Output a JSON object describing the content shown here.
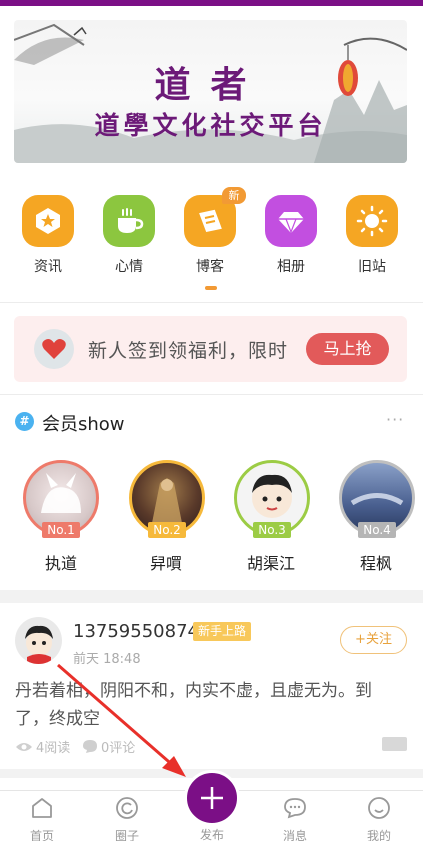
{
  "theme": {
    "brand": "#7b0f86",
    "accent": "#f29a34",
    "promo_btn": "#e25a5a"
  },
  "banner": {
    "title": "道者",
    "subtitle": "道學文化社交平台"
  },
  "quick_nav": [
    {
      "label": "资讯",
      "icon": "star-badge-icon",
      "color": "#f5a623"
    },
    {
      "label": "心情",
      "icon": "coffee-cup-icon",
      "color": "#8cc63f"
    },
    {
      "label": "博客",
      "icon": "ticket-icon",
      "color": "#f5a623",
      "badge": "新"
    },
    {
      "label": "相册",
      "icon": "diamond-icon",
      "color": "#c24fe0"
    },
    {
      "label": "旧站",
      "icon": "sun-icon",
      "color": "#f5a623"
    }
  ],
  "promo": {
    "text": "新人签到领福利，限时",
    "button": "马上抢"
  },
  "members": {
    "badge": "#",
    "title": "会员show",
    "more": "···",
    "items": [
      {
        "rank": "No.1",
        "name": "执道",
        "ring": "#ee7a6a",
        "rank_color": "#ee7a6a"
      },
      {
        "rank": "No.2",
        "name": "舁嘪",
        "ring": "#f6b93b",
        "rank_color": "#f6b93b"
      },
      {
        "rank": "No.3",
        "name": "胡渠江",
        "ring": "#9ccc45",
        "rank_color": "#9ccc45"
      },
      {
        "rank": "No.4",
        "name": "程枫",
        "ring": "#bfbfbf",
        "rank_color": "#b5b5b5"
      }
    ]
  },
  "post": {
    "user": "13759550874",
    "tag": "新手上路",
    "time": "前天 18:48",
    "follow": "+关注",
    "body": "丹若着相，阴阳不和，内实不虚，且虚无为。到了，终成空",
    "reads": "4阅读",
    "comments": "0评论"
  },
  "tabbar": {
    "home": "首页",
    "circle": "圈子",
    "publish": "发布",
    "messages": "消息",
    "mine": "我的"
  }
}
